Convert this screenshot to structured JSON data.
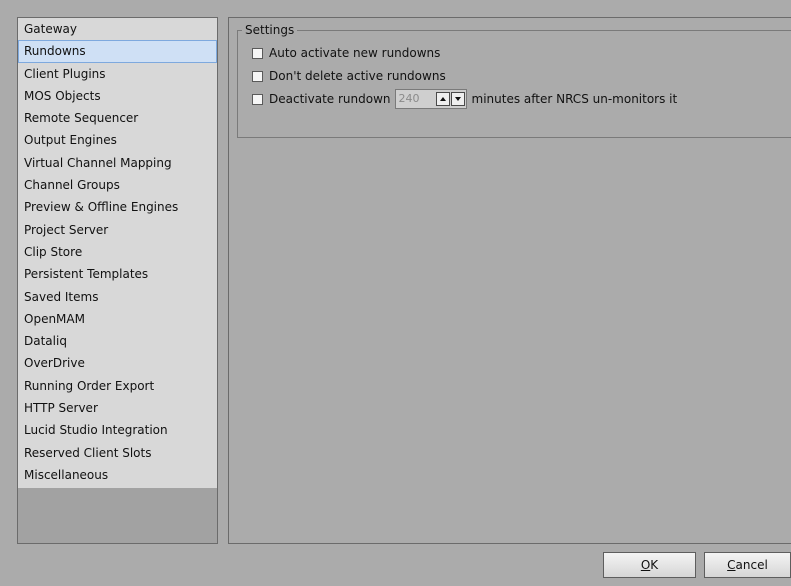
{
  "sidebar": {
    "items": [
      {
        "label": "Gateway",
        "selected": false
      },
      {
        "label": "Rundowns",
        "selected": true
      },
      {
        "label": "Client Plugins",
        "selected": false
      },
      {
        "label": "MOS Objects",
        "selected": false
      },
      {
        "label": "Remote Sequencer",
        "selected": false
      },
      {
        "label": "Output Engines",
        "selected": false
      },
      {
        "label": "Virtual Channel Mapping",
        "selected": false
      },
      {
        "label": "Channel Groups",
        "selected": false
      },
      {
        "label": "Preview & Offline Engines",
        "selected": false
      },
      {
        "label": "Project Server",
        "selected": false
      },
      {
        "label": "Clip Store",
        "selected": false
      },
      {
        "label": "Persistent Templates",
        "selected": false
      },
      {
        "label": "Saved Items",
        "selected": false
      },
      {
        "label": "OpenMAM",
        "selected": false
      },
      {
        "label": "Dataliq",
        "selected": false
      },
      {
        "label": "OverDrive",
        "selected": false
      },
      {
        "label": "Running Order Export",
        "selected": false
      },
      {
        "label": "HTTP Server",
        "selected": false
      },
      {
        "label": "Lucid Studio Integration",
        "selected": false
      },
      {
        "label": "Reserved Client Slots",
        "selected": false
      },
      {
        "label": "Miscellaneous",
        "selected": false
      }
    ]
  },
  "settings": {
    "legend": "Settings",
    "auto_activate": {
      "label": "Auto activate new rundowns",
      "checked": false
    },
    "dont_delete": {
      "label": "Don't delete active rundowns",
      "checked": false
    },
    "deactivate": {
      "label": "Deactivate rundown",
      "checked": false,
      "value": "240",
      "suffix": "minutes after NRCS un-monitors it"
    }
  },
  "buttons": {
    "ok": {
      "underlined": "O",
      "rest": "K"
    },
    "cancel": {
      "underlined": "C",
      "rest": "ancel"
    }
  },
  "colors": {
    "background": "#ababab",
    "list_background": "#d8d8d8",
    "selected_background": "#cfe0f5",
    "selected_border": "#7ea9de"
  }
}
